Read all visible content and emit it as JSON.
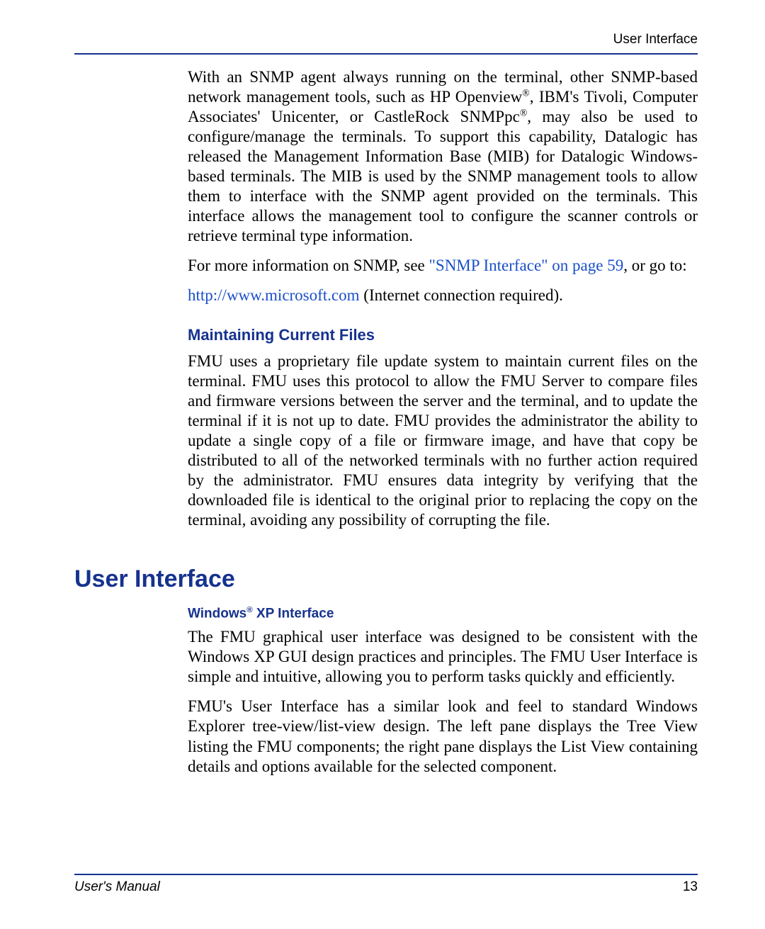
{
  "header": {
    "running_head": "User Interface"
  },
  "paragraphs": {
    "p1_pre": "With an SNMP agent always running on the terminal, other SNMP-based network management tools, such as HP Openview",
    "p1_mid": ", IBM's Tivoli, Computer Associates' Unicenter, or CastleRock SNMPpc",
    "p1_post": ", may also be used to configure/manage the terminals. To support this capability, Datalogic has released the Management Information Base (MIB) for Datalogic Windows-based terminals. The MIB is used by the SNMP management tools to allow them to interface with the SNMP agent provided on the terminals. This interface allows the management tool to configure the scanner controls or retrieve terminal type information.",
    "p2_pre": "For more information on SNMP, see ",
    "p2_link": "\"SNMP Interface\" on page 59",
    "p2_post": ", or go to:",
    "p3_link": "http://www.microsoft.com",
    "p3_post": " (Internet connection required).",
    "h_maintain": "Maintaining Current Files",
    "p4": "FMU uses a proprietary file update system to maintain current files on the terminal. FMU uses this protocol to allow the FMU Server to compare files and firmware versions between the server and the terminal, and to update the terminal if it is not up to date. FMU provides the administrator the ability to update a single copy of a file or firmware image, and have that copy be distributed to all of the networked terminals with no further action required by the administrator. FMU ensures data integrity by verifying that the downloaded file is identical to the original prior to replacing the copy on the terminal, avoiding any possibility of corrupting the file.",
    "h_ui": "User Interface",
    "h_xp_pre": "Windows",
    "h_xp_post": " XP Interface",
    "p5": "The FMU graphical user interface was designed to be consistent with the Windows XP GUI design practices and principles. The FMU User Interface is simple and intuitive, allowing you to perform tasks quickly and efficiently.",
    "p6": "FMU's User Interface has a similar look and feel to standard Windows Explorer tree-view/list-view design. The left pane displays the Tree View listing the FMU components; the right pane displays the List View containing details and options available for the selected component."
  },
  "footer": {
    "left": "User's Manual",
    "right": "13"
  }
}
